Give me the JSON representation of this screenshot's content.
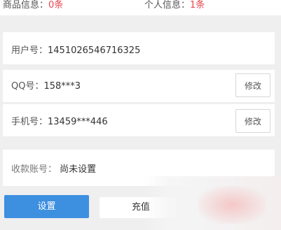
{
  "stats": {
    "goods_label": "商品信息：",
    "goods_value": "0条",
    "personal_label": "个人信息：",
    "personal_value": "1条"
  },
  "account": {
    "user_id_label": "用户号：",
    "user_id_value": "1451026546716325",
    "qq_label": "QQ号：",
    "qq_value": "158***3",
    "qq_edit": "修改",
    "phone_label": "手机号：",
    "phone_value": "13459***446",
    "phone_edit": "修改",
    "bank_label": "收款账号：",
    "bank_value": "尚未设置"
  },
  "actions": {
    "settings_label": "设置",
    "recharge_label": "充值"
  },
  "colors": {
    "accent": "#3d8fe0",
    "highlight": "#e8454f"
  }
}
